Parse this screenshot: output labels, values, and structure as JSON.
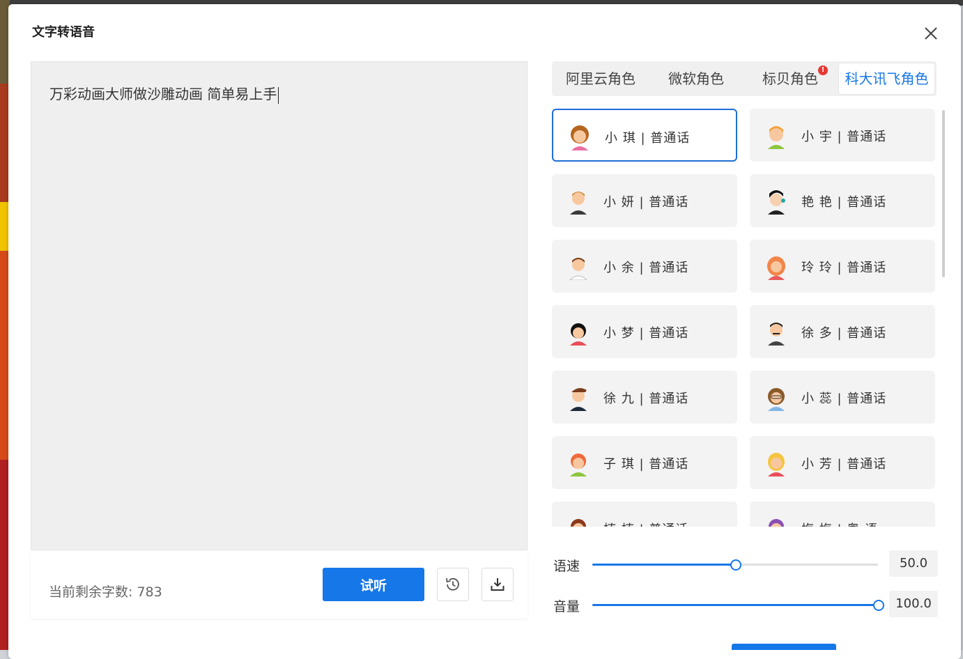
{
  "dialog": {
    "title": "文字转语音"
  },
  "editor": {
    "text": "万彩动画大师做沙雕动画 简单易上手"
  },
  "footer": {
    "remaining_label": "当前剩余字数:",
    "remaining_count": "783",
    "play_label": "试听"
  },
  "tabs": [
    {
      "label": "阿里云角色",
      "active": false,
      "badge": ""
    },
    {
      "label": "微软角色",
      "active": false,
      "badge": ""
    },
    {
      "label": "标贝角色",
      "active": false,
      "badge": "!"
    },
    {
      "label": "科大讯飞角色",
      "active": true,
      "badge": ""
    }
  ],
  "voices": [
    {
      "name": "小 琪 | 普通话",
      "selected": true
    },
    {
      "name": "小 宇 | 普通话",
      "selected": false
    },
    {
      "name": "小 妍 | 普通话",
      "selected": false
    },
    {
      "name": "艳 艳 | 普通话",
      "selected": false
    },
    {
      "name": "小 余 | 普通话",
      "selected": false
    },
    {
      "name": "玲 玲 | 普通话",
      "selected": false
    },
    {
      "name": "小 梦 | 普通话",
      "selected": false
    },
    {
      "name": "徐 多 | 普通话",
      "selected": false
    },
    {
      "name": "徐 九 | 普通话",
      "selected": false
    },
    {
      "name": "小 蕊 | 普通话",
      "selected": false
    },
    {
      "name": "子 琪 | 普通话",
      "selected": false
    },
    {
      "name": "小 芳 | 普通话",
      "selected": false
    },
    {
      "name": "楠 楠 | 普通话",
      "selected": false
    },
    {
      "name": "梅 梅 | 粤 语",
      "selected": false
    }
  ],
  "controls": {
    "speed": {
      "label": "语速",
      "value": "50.0",
      "fraction": 0.5
    },
    "volume": {
      "label": "音量",
      "value": "100.0",
      "fraction": 1.0
    }
  },
  "colors": {
    "accent": "#1677e8",
    "selected_border": "#1f6fd6",
    "badge": "#e53935"
  },
  "icons": {
    "close": "close-icon",
    "history": "history-icon",
    "download": "download-icon"
  }
}
